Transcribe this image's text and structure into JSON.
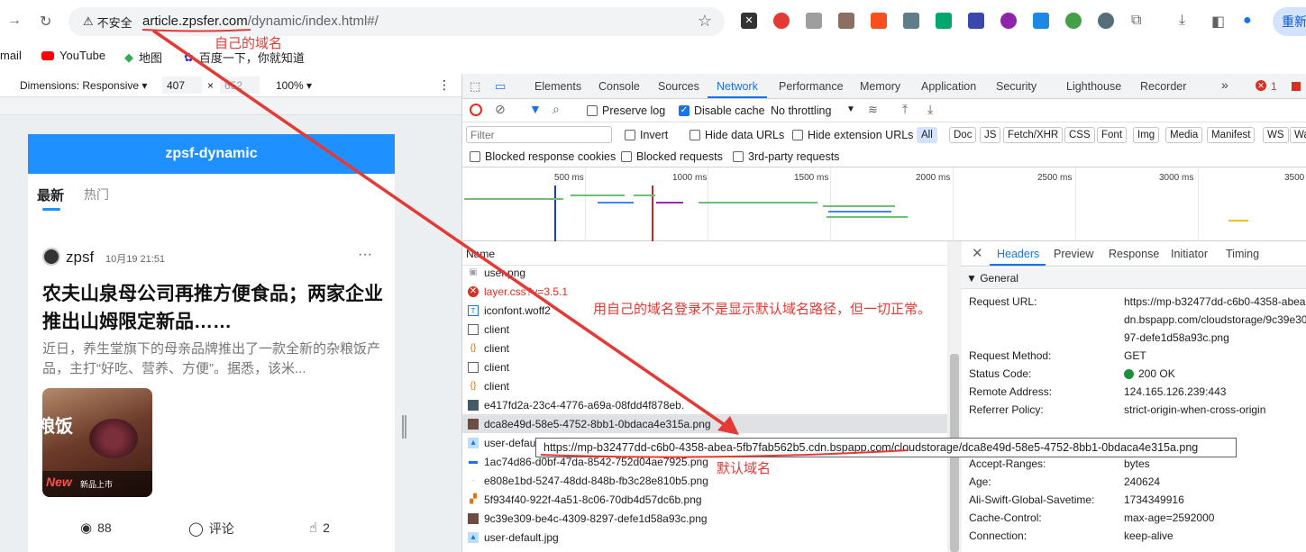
{
  "browser": {
    "insecure_label": "不安全",
    "url_host": "article.zpsfer.com",
    "url_path": "/dynamic/index.html#/",
    "profile_label": "重新"
  },
  "bookmarks": [
    {
      "label": "mail"
    },
    {
      "label": "YouTube"
    },
    {
      "label": "地图"
    },
    {
      "label": "百度一下，你就知道"
    }
  ],
  "device_toolbar": {
    "dimensions": "Dimensions: Responsive",
    "width": "407",
    "times": "×",
    "height": "652",
    "zoom": "100%"
  },
  "app": {
    "title": "zpsf-dynamic",
    "tabs": [
      "最新",
      "热门"
    ],
    "post": {
      "author": "zpsf",
      "time": "10月19 21:51",
      "more": "···",
      "title": "农夫山泉母公司再推方便食品；两家企业推出山姆限定新品……",
      "summary": "近日，养生堂旗下的母亲品牌推出了一款全新的杂粮饭产品，主打“好吃、营养、方便”。据悉，该米...",
      "image_text_left": "粮饭",
      "image_text_bottom": "新品上市",
      "image_logo": "New",
      "views": "88",
      "comment_label": "评论",
      "likes": "2"
    }
  },
  "devtools": {
    "tabs": [
      "Elements",
      "Console",
      "Sources",
      "Network",
      "Performance",
      "Memory",
      "Application",
      "Security",
      "Lighthouse",
      "Recorder"
    ],
    "active_tab": "Network",
    "error_count": "1",
    "toolbar": {
      "preserve_log": "Preserve log",
      "disable_cache": "Disable cache",
      "throttling": "No throttling"
    },
    "filter": {
      "placeholder": "Filter",
      "invert": "Invert",
      "hide_data_urls": "Hide data URLs",
      "hide_extension_urls": "Hide extension URLs",
      "types": [
        "All",
        "Doc",
        "JS",
        "Fetch/XHR",
        "CSS",
        "Font",
        "Img",
        "Media",
        "Manifest",
        "WS",
        "Wa"
      ],
      "blocked_cookies": "Blocked response cookies",
      "blocked_requests": "Blocked requests",
      "third_party": "3rd-party requests"
    },
    "timeline_labels": [
      "500 ms",
      "1000 ms",
      "1500 ms",
      "2000 ms",
      "2500 ms",
      "3000 ms",
      "3500"
    ],
    "list_header": "Name",
    "requests": [
      {
        "name": "user.png",
        "icon": "img",
        "error": false
      },
      {
        "name": "layer.css?v=3.5.1",
        "icon": "error",
        "error": true
      },
      {
        "name": "iconfont.woff2",
        "icon": "font",
        "error": false
      },
      {
        "name": "client",
        "icon": "doc",
        "error": false
      },
      {
        "name": "client",
        "icon": "xhr",
        "error": false
      },
      {
        "name": "client",
        "icon": "doc",
        "error": false
      },
      {
        "name": "client",
        "icon": "xhr",
        "error": false
      },
      {
        "name": "e417fd2a-23c4-4776-a69a-08fdd4f878eb.",
        "icon": "img",
        "error": false
      },
      {
        "name": "dca8e49d-58e5-4752-8bb1-0bdaca4e315a.png",
        "icon": "img",
        "error": false
      },
      {
        "name": "user-default.jpg",
        "icon": "img",
        "error": false
      },
      {
        "name": "1ac74d86-d0bf-47da-8542-752d04ae7925.png",
        "icon": "img",
        "error": false
      },
      {
        "name": "e808e1bd-5247-48dd-848b-fb3c28e810b5.png",
        "icon": "img",
        "error": false
      },
      {
        "name": "5f934f40-922f-4a51-8c06-70db4d57dc6b.png",
        "icon": "img",
        "error": false
      },
      {
        "name": "9c39e309-be4c-4309-8297-defe1d58a93c.png",
        "icon": "img",
        "error": false
      },
      {
        "name": "user-default.jpg",
        "icon": "img",
        "error": false
      }
    ],
    "headers_panel": {
      "tabs": [
        "Headers",
        "Preview",
        "Response",
        "Initiator",
        "Timing"
      ],
      "section_general": "▼ General",
      "request_url_key": "Request URL:",
      "request_url_lines": [
        "https://mp-b32477dd-c6b0-4358-abea",
        "dn.bspapp.com/cloudstorage/9c39e30",
        "97-defe1d58a93c.png"
      ],
      "rows": [
        {
          "key": "Request Method:",
          "value": "GET"
        },
        {
          "key": "Status Code:",
          "value": "200 OK"
        },
        {
          "key": "Remote Address:",
          "value": "124.165.126.239:443"
        },
        {
          "key": "Referrer Policy:",
          "value": "strict-origin-when-cross-origin"
        }
      ],
      "response_rows": [
        {
          "key": "Accept-Ranges:",
          "value": "bytes"
        },
        {
          "key": "Age:",
          "value": "240624"
        },
        {
          "key": "Ali-Swift-Global-Savetime:",
          "value": "1734349916"
        },
        {
          "key": "Cache-Control:",
          "value": "max-age=2592000"
        },
        {
          "key": "Connection:",
          "value": "keep-alive"
        }
      ]
    },
    "tooltip": {
      "host": "https://mp-b32477dd-c6b0-4358-abea-5fb7fab562b5.cdn.bspapp.com",
      "path": "/cloudstorage/dca8e49d-58e5-4752-8bb1-0bdaca4e315a.png"
    }
  },
  "annotations": {
    "own_domain": "自己的域名",
    "note": "用自己的域名登录不是显示默认域名路径，但一切正常。",
    "default_domain": "默认域名"
  },
  "colors": {
    "app_header": "#1e90ff",
    "annotation": "#e53935",
    "devtools_accent": "#1a73e8"
  }
}
